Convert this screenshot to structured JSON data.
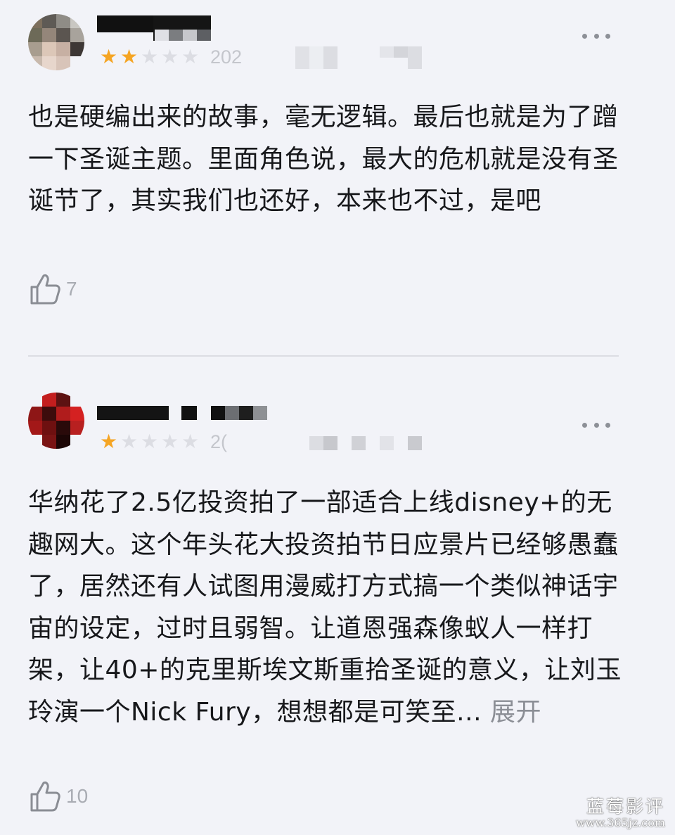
{
  "reviews": [
    {
      "rating": 2,
      "rating_max": 5,
      "votes_text": "202",
      "text": "也是硬编出来的故事，毫无逻辑。最后也就是为了蹭一下圣诞主题。里面角色说，最大的危机就是没有圣诞节了，其实我们也还好，本来也不过，是吧",
      "expand_label": "",
      "likes": "7"
    },
    {
      "rating": 1,
      "rating_max": 5,
      "votes_text": "2(",
      "text": "华纳花了2.5亿投资拍了一部适合上线disney+的无趣网大。这个年头花大投资拍节日应景片已经够愚蠢了，居然还有人试图用漫威打方式搞一个类似神话宇宙的设定，过时且弱智。让道恩强森像蚁人一样打架，让40+的克里斯埃文斯重拾圣诞的意义，让刘玉玲演一个Nick Fury，想想都是可笑至... ",
      "expand_label": "展开",
      "likes": "10"
    }
  ],
  "watermark": {
    "title": "蓝莓影评",
    "url": "www.365jz.com"
  },
  "colors": {
    "background": "#f2f3f8",
    "star_on": "#f5a524",
    "star_off": "#dcdde3",
    "text": "#17181b",
    "muted": "#a9acb3",
    "divider": "#dcdde3"
  },
  "icons": {
    "like": "thumbs-up-icon",
    "more": "more-dots-icon",
    "star": "star-icon"
  }
}
